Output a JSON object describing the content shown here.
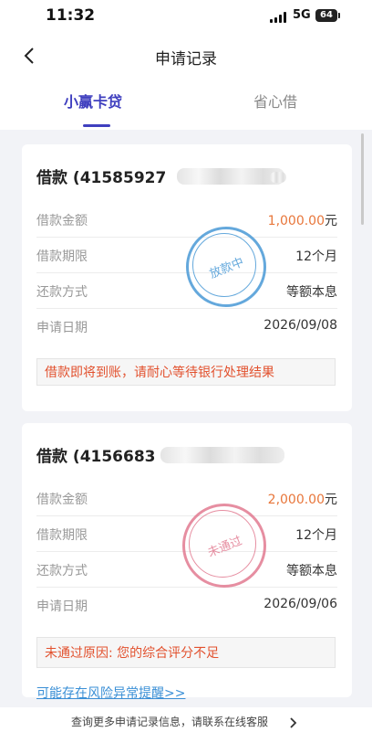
{
  "status_bar": {
    "time": "11:32",
    "network": "5G",
    "battery": "64"
  },
  "nav": {
    "title": "申请记录"
  },
  "tabs": [
    {
      "label": "小赢卡贷",
      "active": true
    },
    {
      "label": "省心借",
      "active": false
    }
  ],
  "cards": [
    {
      "title": "借款 (41585927",
      "rows": [
        {
          "label": "借款金额",
          "amount": "1,000.00",
          "unit": "元"
        },
        {
          "label": "借款期限",
          "value": "12个月"
        },
        {
          "label": "还款方式",
          "value": "等额本息"
        },
        {
          "label": "申请日期",
          "value": "2026/09/08"
        }
      ],
      "stamp": {
        "text": "放款中",
        "color": "#4a9ad6"
      },
      "notice": "借款即将到账，请耐心等待银行处理结果"
    },
    {
      "title": "借款 (4156683",
      "rows": [
        {
          "label": "借款金额",
          "amount": "2,000.00",
          "unit": "元"
        },
        {
          "label": "借款期限",
          "value": "12个月"
        },
        {
          "label": "还款方式",
          "value": "等额本息"
        },
        {
          "label": "申请日期",
          "value": "2026/09/06"
        }
      ],
      "stamp": {
        "text": "未通过",
        "color": "#e0728a"
      },
      "notice": "未通过原因: 您的综合评分不足"
    }
  ],
  "risk_link": "可能存在风险异常提醒>>",
  "footer": {
    "text": "查询更多申请记录信息，请联系在线客服"
  },
  "colors": {
    "accent": "#3f3fbf",
    "amount": "#e8763a",
    "warning": "#e2512e",
    "link": "#3a8fd6"
  }
}
